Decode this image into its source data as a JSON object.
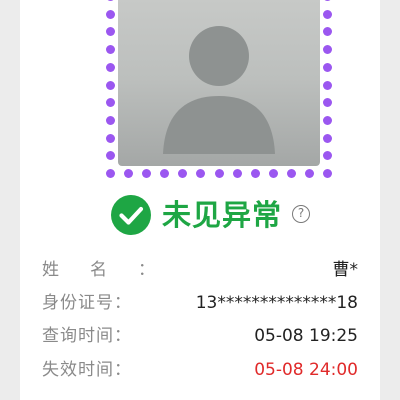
{
  "status": {
    "text": "未见异常",
    "help_glyph": "?",
    "color": "#1ea644"
  },
  "frame_color": "#9b57f0",
  "photo": {
    "icon": "person-silhouette-icon"
  },
  "info": [
    {
      "label": "姓名：",
      "value": "曹*"
    },
    {
      "label": "身份证号：",
      "value": "13**************18"
    },
    {
      "label": "查询时间：",
      "value": "05-08 19:25"
    },
    {
      "label": "失效时间：",
      "value": "05-08 24:00"
    }
  ],
  "expiry_color": "#e02a2a"
}
